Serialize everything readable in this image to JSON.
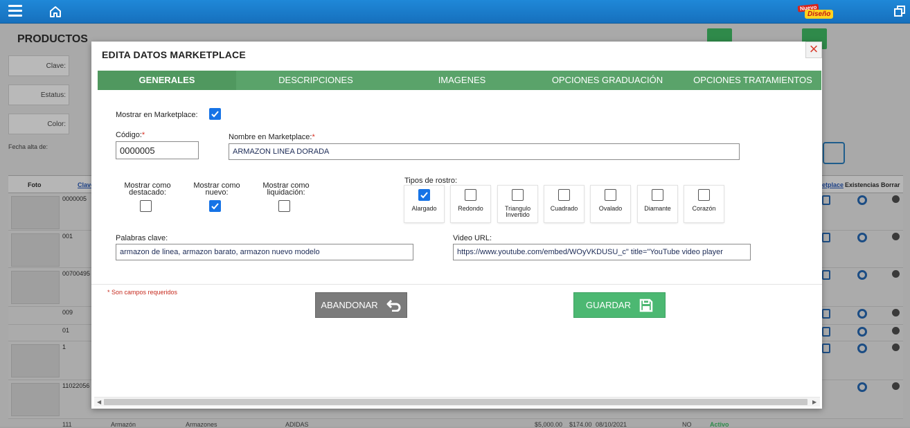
{
  "page": {
    "title": "PRODUCTOS",
    "filters": {
      "clave": "Clave:",
      "estatus": "Estatus:",
      "color": "Color:",
      "fecha": "Fecha alta de:"
    },
    "columns": {
      "foto": "Foto",
      "clave": "Clave",
      "marketplace": "etplace",
      "existencias": "Existencias",
      "borrar": "Borrar"
    },
    "row_codes": [
      "0000005",
      "001",
      "00700495",
      "009",
      "01",
      "1",
      "11022056",
      "111"
    ],
    "bottom_row": [
      "Armazón",
      "Armazones",
      "ADIDAS",
      "$5,000.00",
      "$174.00",
      "08/10/2021",
      "NO",
      "Activo"
    ]
  },
  "topbar": {
    "badge_top": "Nuevo",
    "badge_bottom": "Diseño"
  },
  "modal": {
    "title": "EDITA DATOS MARKETPLACE",
    "close_label": "×",
    "tabs": [
      "GENERALES",
      "DESCRIPCIONES",
      "IMAGENES",
      "OPCIONES GRADUACIÓN",
      "OPCIONES TRATAMIENTOS"
    ],
    "active_tab": "GENERALES",
    "show_marketplace_label": "Mostrar en Marketplace:",
    "show_marketplace": true,
    "code_label": "Código:",
    "code_value": "0000005",
    "name_label": "Nombre en Marketplace:",
    "name_value": "ARMAZON LINEA DORADA",
    "required_mark": "*",
    "featured_label": "Mostrar como destacado:",
    "featured": false,
    "new_label": "Mostrar como nuevo:",
    "new": true,
    "clearance_label": "Mostrar como liquidación:",
    "clearance": false,
    "face_types_label": "Tipos de rostro:",
    "face_types": [
      {
        "label": "Alargado",
        "checked": true
      },
      {
        "label": "Redondo",
        "checked": false
      },
      {
        "label": "Triangulo Invertido",
        "checked": false
      },
      {
        "label": "Cuadrado",
        "checked": false
      },
      {
        "label": "Ovalado",
        "checked": false
      },
      {
        "label": "Diamante",
        "checked": false
      },
      {
        "label": "Corazón",
        "checked": false
      }
    ],
    "keywords_label": "Palabras clave:",
    "keywords_value": "armazon de linea, armazon barato, armazon nuevo modelo",
    "video_label": "Video URL:",
    "video_value": "https://www.youtube.com/embed/WOyVKDUSU_c\" title=\"YouTube video player",
    "required_note": "* Son campos requeridos",
    "abandon_label": "ABANDONAR",
    "save_label": "GUARDAR"
  },
  "colors": {
    "topbar": "#1a7ccb",
    "tabs": "#5aa36a",
    "save": "#4cb872",
    "abandon": "#7b7b7b",
    "check": "#1673e6"
  }
}
